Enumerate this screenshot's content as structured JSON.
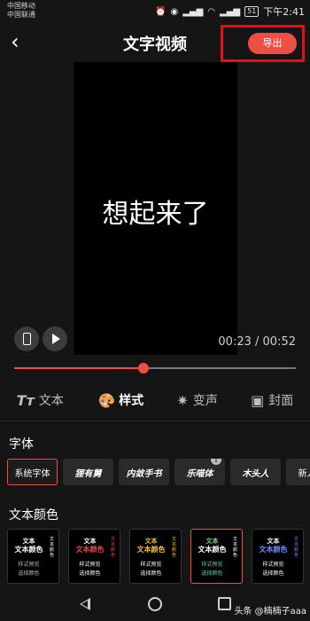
{
  "status_bar": {
    "carrier1": "中国移动",
    "carrier2": "中国联通",
    "icons": [
      "alarm-icon",
      "eye-icon",
      "signal-4g-icon",
      "wifi-icon",
      "signal-icon"
    ],
    "battery": "51",
    "time": "下午2:41"
  },
  "header": {
    "title": "文字视频",
    "export_label": "导出",
    "back_icon": "chevron-left-icon"
  },
  "preview": {
    "text": "想起来了",
    "current_time": "00:23",
    "separator": " / ",
    "duration": "00:52",
    "progress": 0.46
  },
  "tabs": [
    {
      "icon": "Tт",
      "label": "文本",
      "active": false
    },
    {
      "icon": "🎨",
      "label": "样式",
      "active": true
    },
    {
      "icon": "✷",
      "label": "变声",
      "active": false
    },
    {
      "icon": "▣",
      "label": "封面",
      "active": false
    }
  ],
  "fonts": {
    "section_title": "字体",
    "items": [
      "系统字体",
      "狸有舅",
      "内敛手书",
      "乐喵体",
      "木头人",
      "新人文"
    ],
    "selected_index": 0,
    "download_badge": "↓"
  },
  "colors": {
    "section_title": "文本颜色",
    "card_lines": {
      "l1": "文本",
      "l2": "文本颜色",
      "l4": "样式预览",
      "l5": "选择颜色"
    },
    "cards": [
      {
        "c1": "#ffffff",
        "c2": "#ffffff",
        "c3": "#bbbbbb"
      },
      {
        "c1": "#ffffff",
        "c2": "#e04a4a",
        "c3": "#ffffff"
      },
      {
        "c1": "#f1c232",
        "c2": "#f1c232",
        "c3": "#ffffff"
      },
      {
        "c1": "#7fd37f",
        "c2": "#ffffff",
        "c3": "#5fd3b0"
      },
      {
        "c1": "#ffffff",
        "c2": "#6f8cff",
        "c3": "#ffffff"
      }
    ],
    "selected_index": 3
  },
  "watermark": "头条 @楠楠子aaa"
}
